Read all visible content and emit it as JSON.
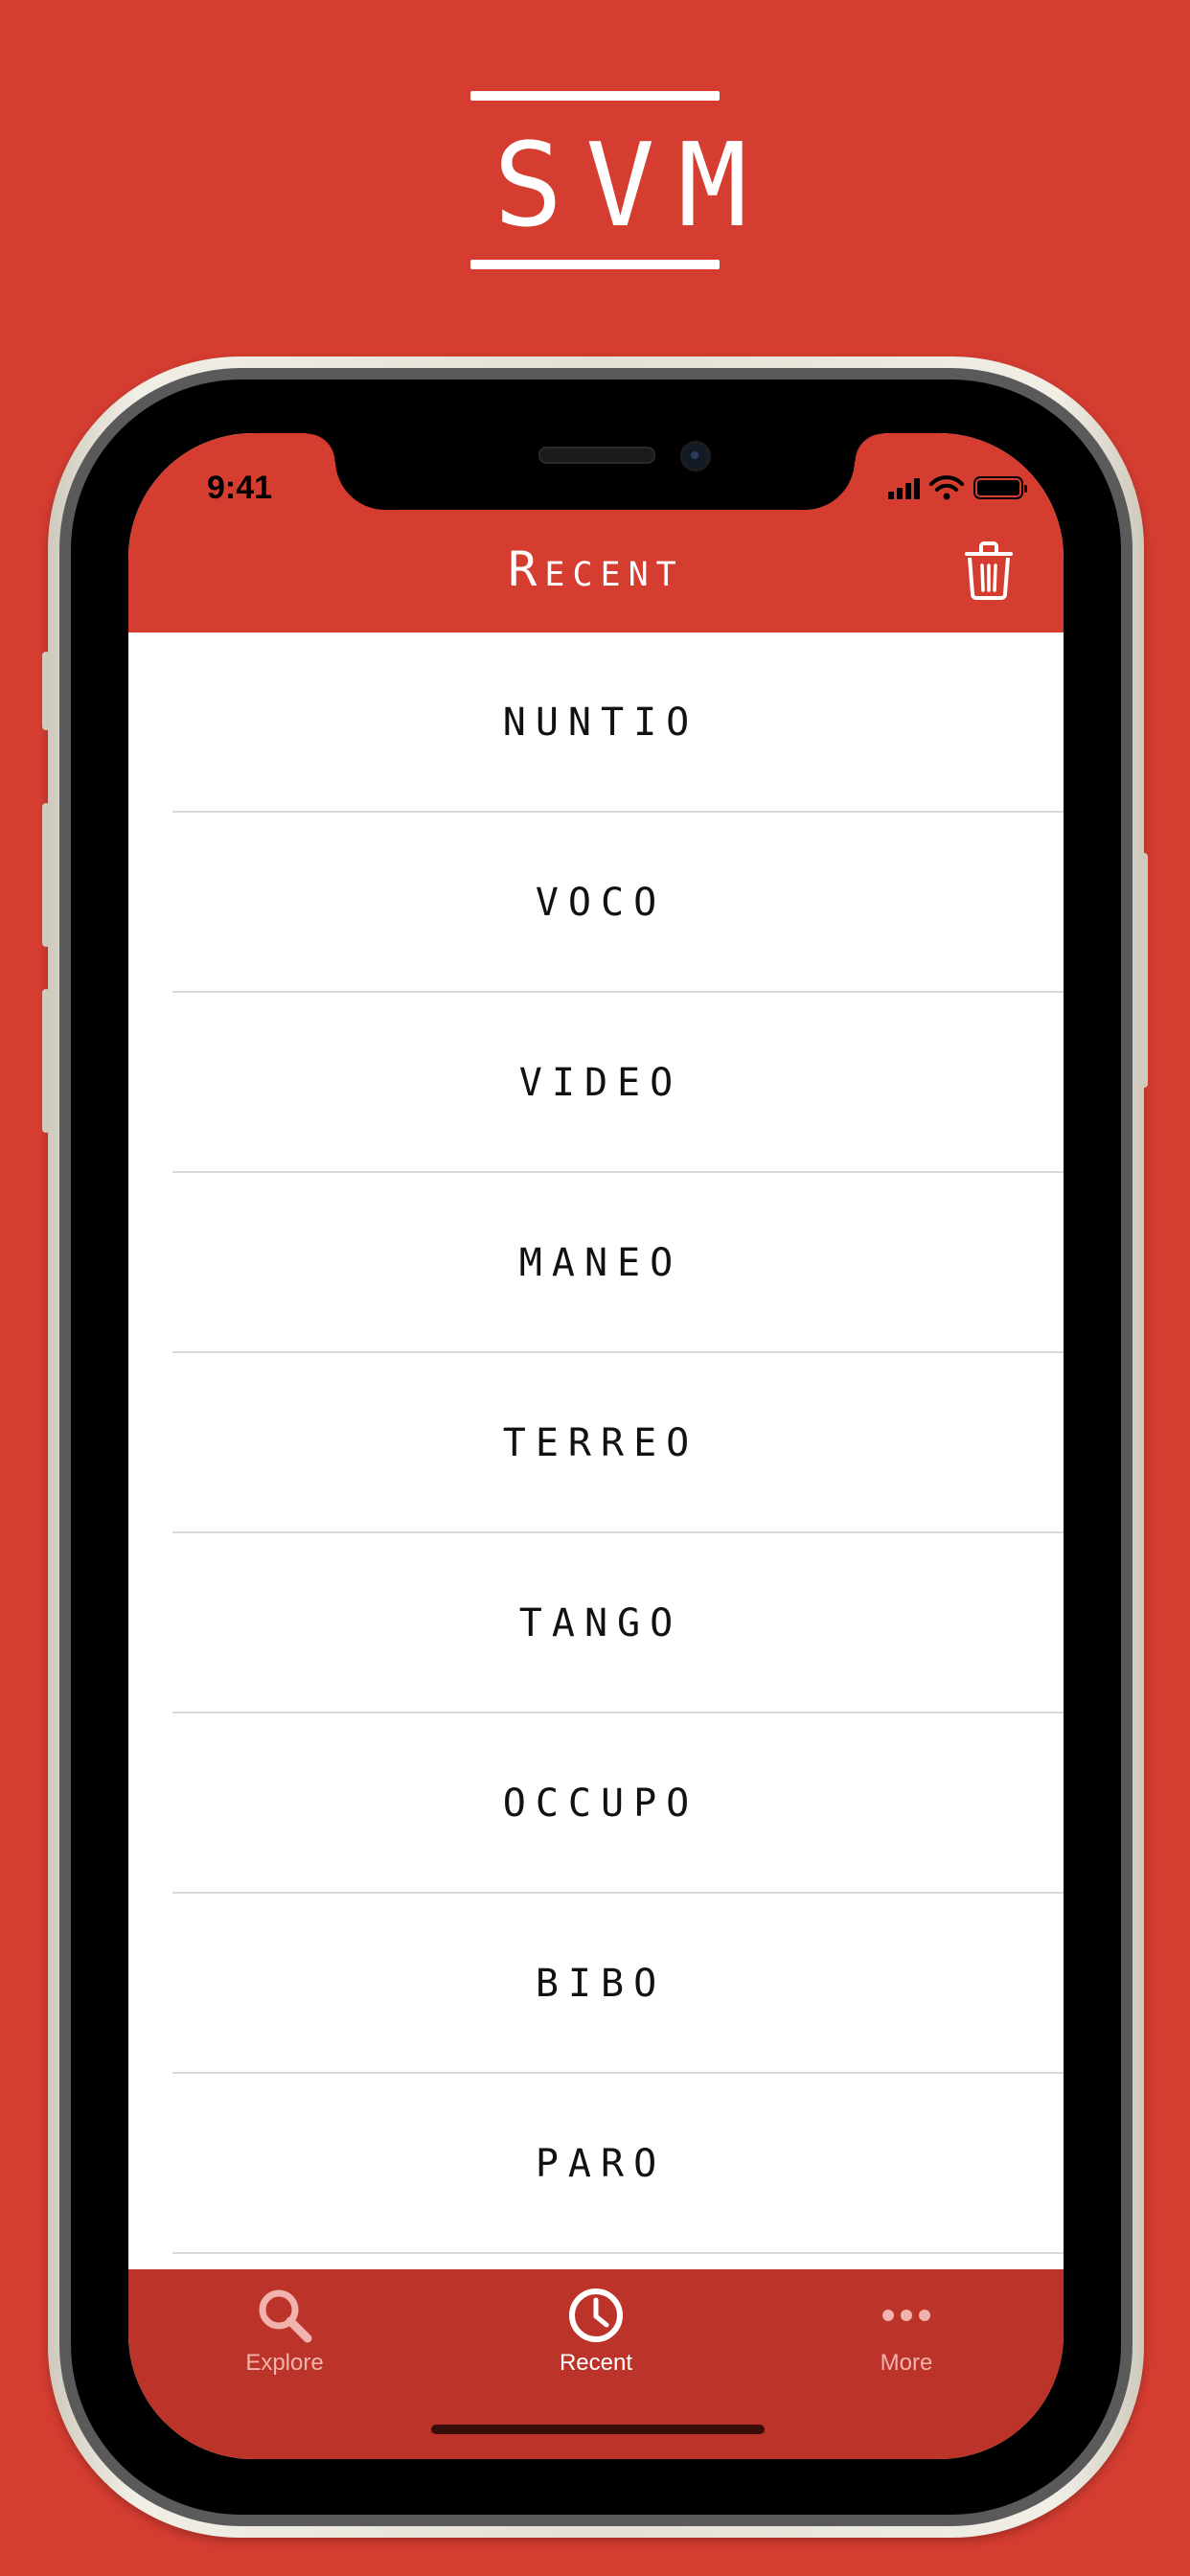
{
  "logo": {
    "text": "SVM"
  },
  "status_bar": {
    "time": "9:41"
  },
  "header": {
    "title": "Recent",
    "action_icon": "trash-icon"
  },
  "list": {
    "items": [
      "NUNTIO",
      "VOCO",
      "VIDEO",
      "MANEO",
      "TERREO",
      "TANGO",
      "OCCUPO",
      "BIBO",
      "PARO"
    ]
  },
  "tabbar": {
    "tabs": [
      {
        "label": "Explore",
        "icon": "magnifying-glass-icon",
        "active": false
      },
      {
        "label": "Recent",
        "icon": "clock-icon",
        "active": true
      },
      {
        "label": "More",
        "icon": "ellipsis-icon",
        "active": false
      }
    ]
  },
  "colors": {
    "brand_red": "#D63D31",
    "tabbar_red": "#BC3429",
    "list_background": "#FFFFFF",
    "separator": "#D9D9D9"
  }
}
